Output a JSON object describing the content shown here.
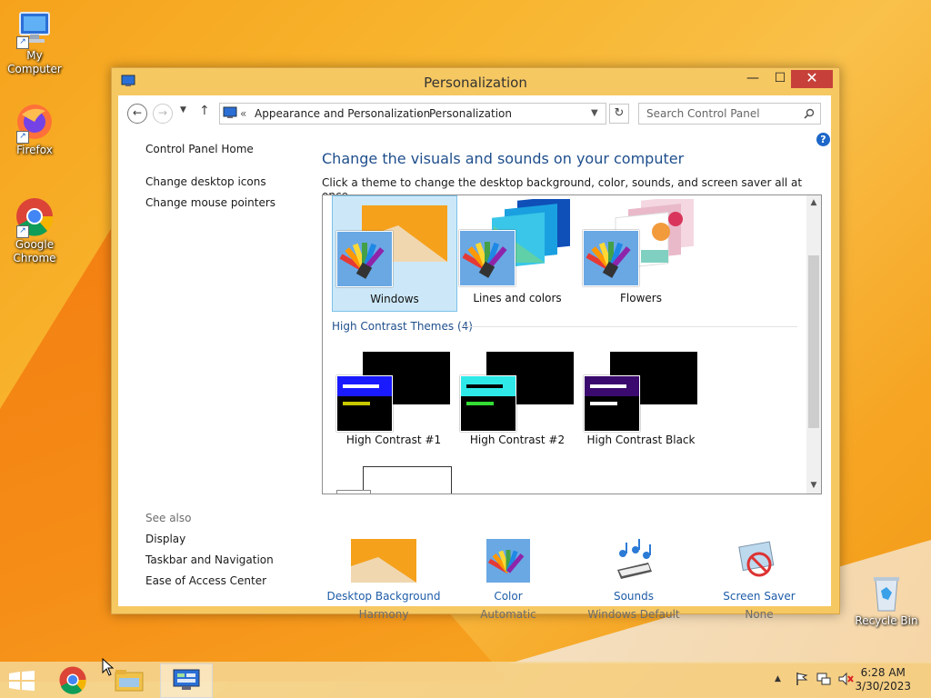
{
  "desktop": {
    "icons": [
      {
        "label": "My Computer"
      },
      {
        "label": "Firefox"
      },
      {
        "label": "Google Chrome"
      },
      {
        "label": "Recycle Bin"
      }
    ]
  },
  "window": {
    "title": "Personalization",
    "controls": {
      "minimize": "—",
      "maximize": "☐",
      "close": "✕"
    }
  },
  "address_bar": {
    "prefix": "«",
    "crumbs": [
      "Appearance and Personalization",
      "Personalization"
    ],
    "separator": "›",
    "search_placeholder": "Search Control Panel"
  },
  "left_panel": {
    "links": [
      "Control Panel Home",
      "Change desktop icons",
      "Change mouse pointers"
    ],
    "see_also_title": "See also",
    "see_also": [
      "Display",
      "Taskbar and Navigation",
      "Ease of Access Center"
    ]
  },
  "main": {
    "heading": "Change the visuals and sounds on your computer",
    "subheading": "Click a theme to change the desktop background, color, sounds, and screen saver all at once.",
    "help": "?"
  },
  "themes": {
    "my_themes": [
      {
        "label": "Windows",
        "selected": true
      },
      {
        "label": "Lines and colors",
        "selected": false
      },
      {
        "label": "Flowers",
        "selected": false
      }
    ],
    "high_contrast_header": "High Contrast Themes (4)",
    "high_contrast": [
      {
        "label": "High Contrast #1",
        "accent": "#1a1aff"
      },
      {
        "label": "High Contrast #2",
        "accent": "#2fe9e9"
      },
      {
        "label": "High Contrast Black",
        "accent": "#3b0a6e"
      }
    ]
  },
  "bottom": [
    {
      "label": "Desktop Background",
      "value": "Harmony"
    },
    {
      "label": "Color",
      "value": "Automatic"
    },
    {
      "label": "Sounds",
      "value": "Windows Default"
    },
    {
      "label": "Screen Saver",
      "value": "None"
    }
  ],
  "taskbar": {
    "time": "6:28 AM",
    "date": "3/30/2023"
  },
  "colors": {
    "link": "#1e4e8c",
    "selection": "#cce8f8",
    "close_button": "#c7413a"
  }
}
